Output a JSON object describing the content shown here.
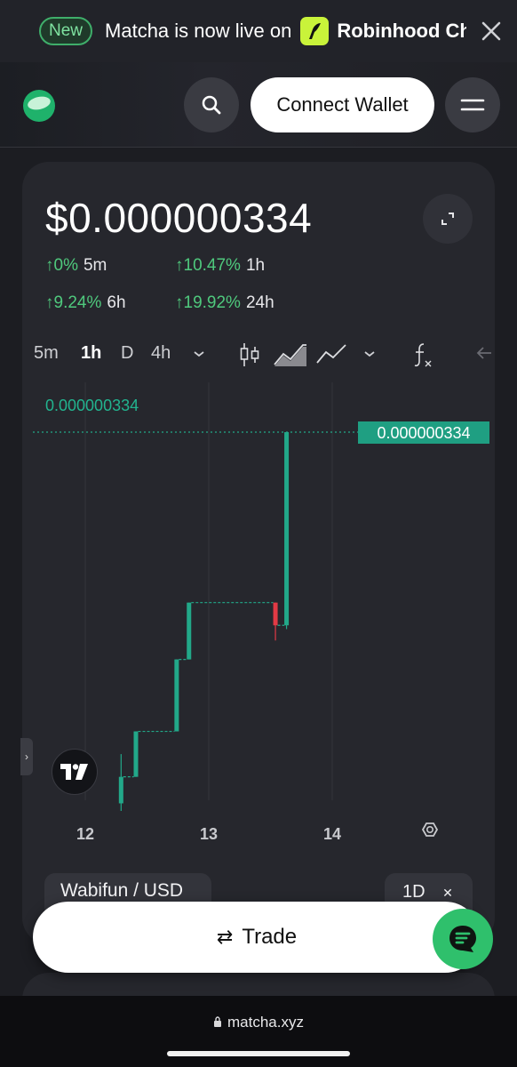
{
  "banner": {
    "badge": "New",
    "text": "Matcha is now live on",
    "partner": "Robinhood Ch"
  },
  "header": {
    "connect_label": "Connect Wallet"
  },
  "price_card": {
    "price": "$0.000000334",
    "changes": [
      {
        "pct": "↑0%",
        "period": "5m"
      },
      {
        "pct": "↑10.47%",
        "period": "1h"
      },
      {
        "pct": "↑9.24%",
        "period": "6h"
      },
      {
        "pct": "↑19.92%",
        "period": "24h"
      }
    ]
  },
  "toolbar": {
    "intervals": [
      "5m",
      "1h",
      "D",
      "4h"
    ],
    "active_interval": "1h",
    "icons": [
      "candles-icon",
      "area-chart-icon",
      "line-chart-icon",
      "chevron-down-icon",
      "function-icon",
      "back-arrow-icon"
    ]
  },
  "chart": {
    "last_value_label": "0.000000334",
    "price_tag": "0.000000334",
    "x_ticks": [
      "12",
      "13",
      "14"
    ]
  },
  "chart_data": {
    "type": "candlestick",
    "x_ticks": [
      "12",
      "13",
      "14"
    ],
    "last_price": "0.000000334",
    "candles_relative": [
      {
        "x": 12.29,
        "open": 0.02,
        "close": 0.09,
        "high": 0.15,
        "low": 0.0,
        "color": "up"
      },
      {
        "x": 12.41,
        "open": 0.09,
        "close": 0.21,
        "high": 0.21,
        "low": 0.09,
        "color": "up"
      },
      {
        "x": 12.74,
        "open": 0.21,
        "close": 0.4,
        "high": 0.4,
        "low": 0.21,
        "color": "up"
      },
      {
        "x": 12.84,
        "open": 0.4,
        "close": 0.55,
        "high": 0.55,
        "low": 0.4,
        "color": "up"
      },
      {
        "x": 13.54,
        "open": 0.55,
        "close": 0.49,
        "high": 0.55,
        "low": 0.45,
        "color": "down"
      },
      {
        "x": 13.63,
        "open": 0.49,
        "close": 1.0,
        "high": 1.0,
        "low": 0.48,
        "color": "up"
      }
    ],
    "colors": {
      "up": "#22a889",
      "down": "#e33a45",
      "price_line": "#22a889"
    }
  },
  "pair": {
    "label": "Wabifun / USD",
    "range": "1D"
  },
  "trade": {
    "swap_glyph": "⇄",
    "label": "Trade"
  },
  "browser": {
    "url": "matcha.xyz"
  }
}
